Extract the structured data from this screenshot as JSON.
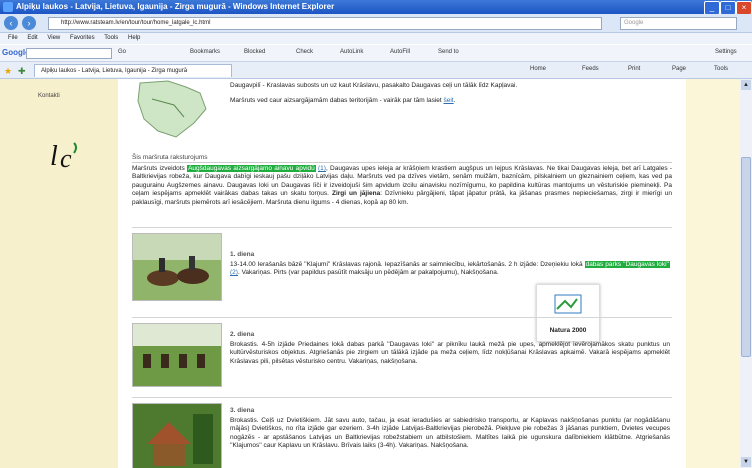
{
  "window": {
    "title": "Alpiķu laukos - Latvija, Lietuva, Igaunija - Zirga mugurā - Windows Internet Explorer"
  },
  "address": {
    "url": "http://www.ratsteam.lv/en/tour/tour/home_latgale_lc.html",
    "search_placeholder": "Google"
  },
  "menu": [
    "File",
    "Edit",
    "View",
    "Favorites",
    "Tools",
    "Help"
  ],
  "google_bar": {
    "logo": "Google",
    "items": [
      "Go",
      "Bookmarks",
      "Blocked",
      "Check",
      "AutoLink",
      "AutoFill",
      "Send to",
      "Settings"
    ]
  },
  "tab": {
    "label": "Alpiķu laukos - Latvija, Lietuva, Igaunija - Zirga mugurā"
  },
  "tab_tools": [
    "Home",
    "Feeds",
    "Print",
    "Page",
    "Tools"
  ],
  "sidebar": {
    "link1": "",
    "link2": "Kontakti",
    "logo_text": "lc"
  },
  "intro": {
    "line1": "Daugavpilī - Kraslavas subosts un uz kaut Krāslavu, pasakalto Daugavas ceļi un tālāk līdz Kapļavai.",
    "line2": "Maršruts ved caur aizsargājamām dabas teritorijām - vairāk par tām lasiet",
    "line2_link": "šeit"
  },
  "section": {
    "title": "Šis maršruta raksturojums",
    "text_before": "Maršruts izveidots",
    "highlight1": "Augšdaugavas aizsargājamo ainavu apvidū",
    "highlight1_link": "(1)",
    "text_after": ", Daugavas upes ieleja ar krāšņiem krastiem augšpus un lejpus Krāslavas. Ne tikai Daugavas ieleja, bet arī Latgales - Baltkrievijas robeža, kur Daugava dabīgi ieskauj pašu dziļāko Latvijas daļu. Maršruts ved pa dzīves vietām, senām muižām, baznīcām, pilskalniem un gleznainiem ceļiem, kas ved pa paugurainu Augšzemes ainavu. Daugavas loki un Daugavas līči ir izveidojuši šim apvidum izcilu ainavisku nozīmīgumu, ko papildina kultūras mantojums un vēsturiskie pieminekļi. Pa ceļam iespējams apmeklēt vairākas dabas takas un skatu torņus.",
    "bold_label": "Zirgi un jājiena",
    "text_end": ": Dzīvnieku pārgājieni, tāpat jāpatur prātā, ka jāšanas prasmes nepieciešamas, zirgi ir mierīgi un paklausīgi, maršruts piemērots arī iesācējiem. Maršruta dienu ilgums - 4 dienas, kopā ap 80 km."
  },
  "days": [
    {
      "title": "1. diena",
      "text": "13-14.00 Ierašanās bāzē ''Klajumi'' Krāslavas rajonā. Iepazīšanās ar saimniecību, iekārtošanās. 2 h izjāde: Dzeņiekiu lokā",
      "highlight": "dabas parks ''Daugavas loki''",
      "highlight_link": "(2)",
      "text_end": ". Vakariņas. Pirts (var papildus pasūtīt maksāju un pēdējām ar pakalpojumu), Nakšņošana."
    },
    {
      "title": "2. diena",
      "text": "Brokastis. 4-5h izjāde Priedaines lokā dabas parkā ''Daugavas loki'' ar piknīku laukā mežā pie upes, apmeklējot ievērojamākos skatu punktus un kultūrvēsturiskos objektus. Atgriešanās pie zirgiem un tālākā izjāde pa meža ceļiem, līdz nokļūšanai Krāslavas apkaimē. Vakarā iespējams apmeklēt Krāslavas pili, pilsētas vēsturisko centru. Vakariņas, nakšņošana."
    },
    {
      "title": "3. diena",
      "text": "Brokastis. Ceļš uz Dvietiškiem. Jāt savu auto, tačau, ja esat ieradušies ar sabiedrisko transportu, ar Kaplavas nakšņošanas punktu (ar nogādāšanu mājās) Dvietiškos, no rīta izjāde gar ezeriem. 3-4h izjāde Latvijas-Baltkrievijas pierobežā. Piekļuve pie robežas 3 jāšanas punktiem, Dvietes vecupes nogāzēs - ar apstāšanos Latvijas un Baltkrievijas robežstabiem un atbilstošiem. Maltītes laikā pie ugunskura dalībniekiem klātbūtne. Atgriešanās ''Klajumos'' caur Kaplavu un Krāslavu. Brīvais laiks (3-4h). Vakariņas. Nakšņošana."
    }
  ],
  "natura": {
    "label": "Natura 2000"
  }
}
